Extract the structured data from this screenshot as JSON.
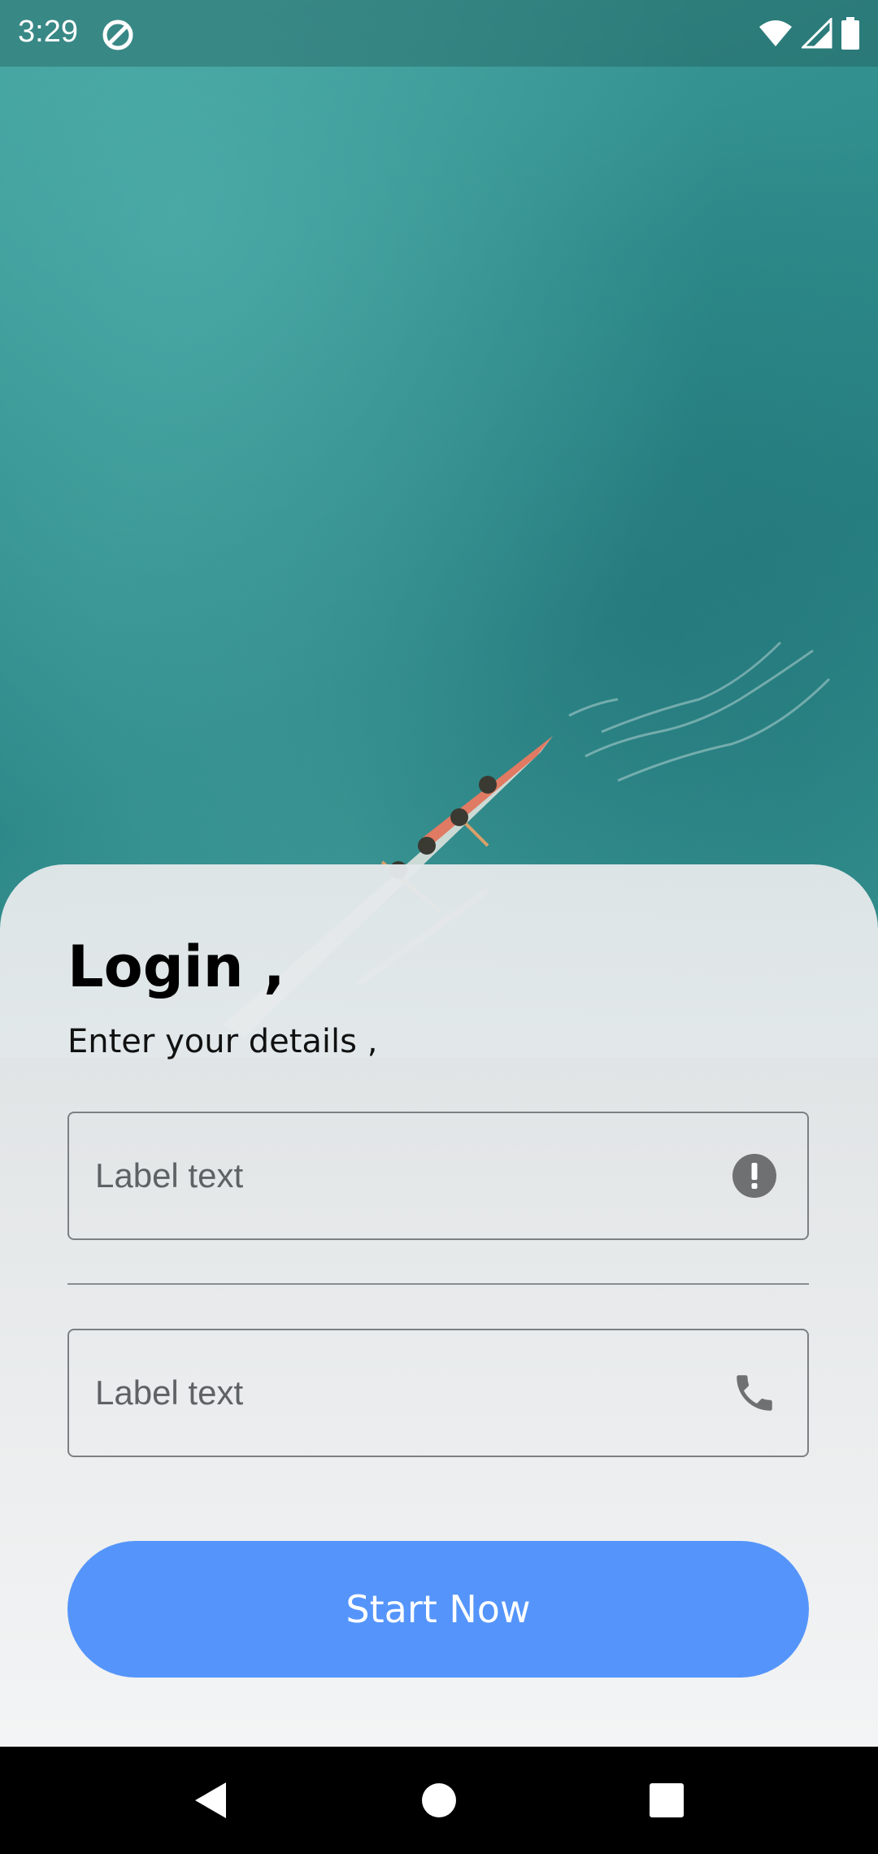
{
  "status_bar": {
    "time": "3:29",
    "left_icon": "do-not-disturb-icon",
    "right_icons": [
      "wifi-icon",
      "signal-icon",
      "battery-icon"
    ]
  },
  "login": {
    "title": "Login ,",
    "subtitle": "Enter your details ,",
    "field_1": {
      "label": "Label text",
      "icon": "error-icon"
    },
    "field_2": {
      "label": "Label text",
      "icon": "phone-icon"
    },
    "start_button_label": "Start Now"
  },
  "nav_bar": {
    "buttons": [
      "back-icon",
      "home-icon",
      "recents-icon"
    ]
  },
  "colors": {
    "accent": "#5595fb",
    "ocean": "#2f8d8c",
    "card": "#eceeef"
  }
}
